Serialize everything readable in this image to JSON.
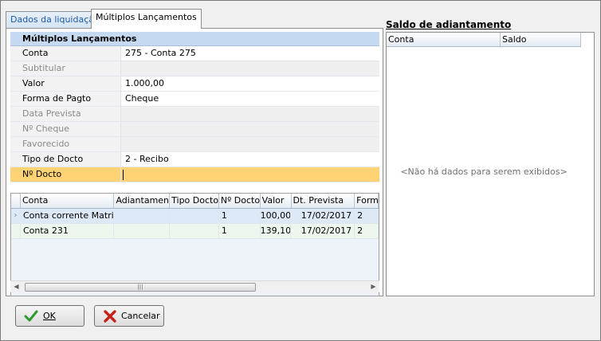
{
  "tabs": [
    {
      "label": "Dados da liquidação"
    },
    {
      "label": "Múltiplos Lançamentos"
    }
  ],
  "property_grid": {
    "header": "Múltiplos Lançamentos",
    "rows": [
      {
        "label": "Conta",
        "value": "275 - Conta 275"
      },
      {
        "label": "Subtitular",
        "value": ""
      },
      {
        "label": "Valor",
        "value": "1.000,00"
      },
      {
        "label": "Forma de Pagto",
        "value": "Cheque"
      },
      {
        "label": "Data Prevista",
        "value": ""
      },
      {
        "label": "Nº Cheque",
        "value": ""
      },
      {
        "label": "Favorecido",
        "value": ""
      },
      {
        "label": "Tipo de Docto",
        "value": "2 - Recibo"
      },
      {
        "label": "Nº Docto",
        "value": ""
      }
    ]
  },
  "grid": {
    "columns": [
      "Conta",
      "Adiantamento",
      "Tipo Docto.",
      "Nº Docto.",
      "Valor",
      "Dt. Prevista",
      "Forma"
    ],
    "rows": [
      {
        "conta": "Conta corrente Matriz",
        "adiantamento": "",
        "tipo_docto": "",
        "n_docto": "1",
        "valor": "100,00",
        "dt_prevista": "17/02/2017",
        "forma": "2"
      },
      {
        "conta": "Conta 231",
        "adiantamento": "",
        "tipo_docto": "",
        "n_docto": "1",
        "valor": "139,10",
        "dt_prevista": "17/02/2017",
        "forma": "2"
      }
    ],
    "row_indicator": "›"
  },
  "scrollbar": {
    "left": "◀",
    "right": "▶",
    "grip": "|||"
  },
  "saldo": {
    "title": "Saldo de adiantamento",
    "columns": [
      "Conta",
      "Saldo"
    ],
    "empty_text": "<Não há dados para serem exibidos>"
  },
  "buttons": {
    "ok_label": "OK",
    "cancel_label": "Cancelar"
  },
  "colors": {
    "selected_row": "#ffd373",
    "accent": "#c5d9f1"
  }
}
